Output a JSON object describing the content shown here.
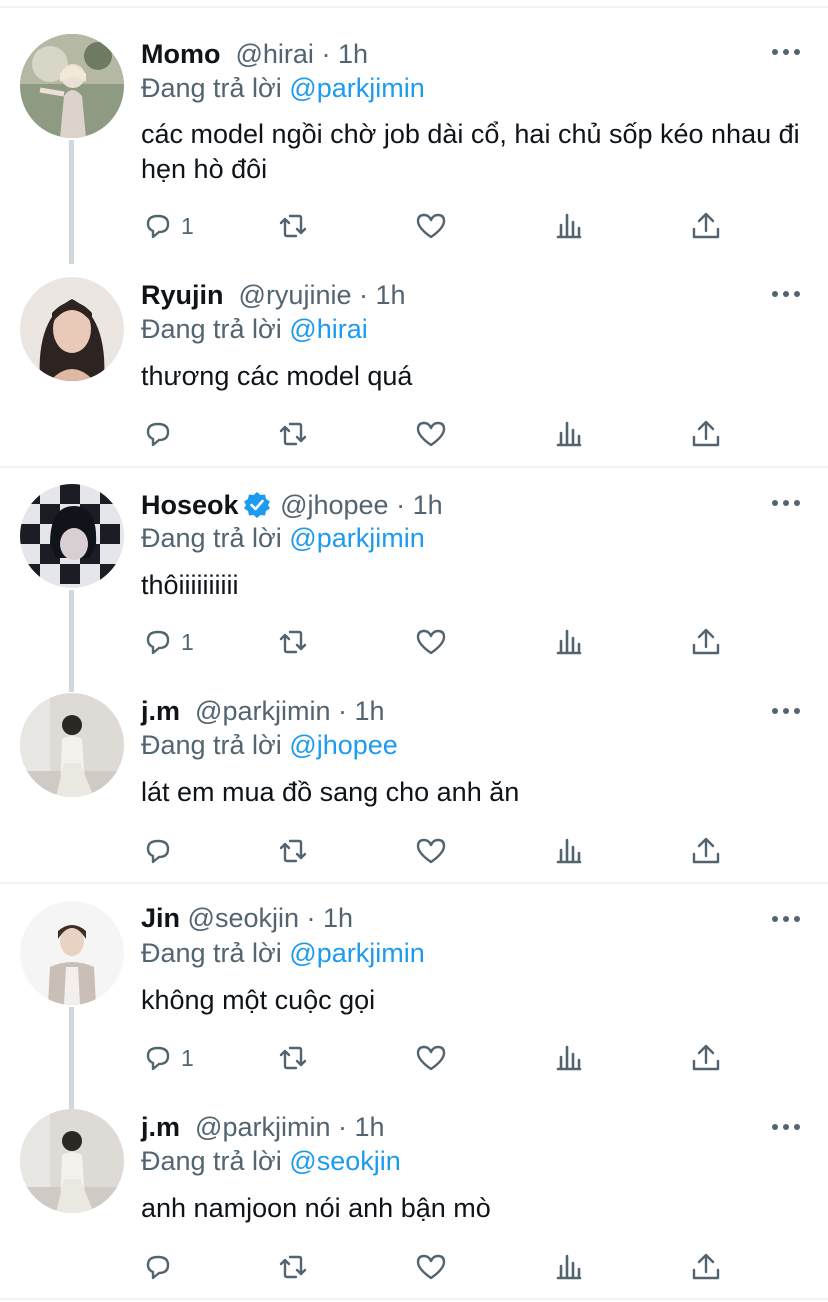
{
  "reply_prefix": "Đang trả lời",
  "colors": {
    "accent": "#1d9bf0",
    "secondary": "#536471",
    "thread_line": "#cfd9de",
    "divider": "#eff3f4"
  },
  "tweets": [
    {
      "name": "Momo",
      "handle": "@hirai",
      "time": "· 1h",
      "verified": false,
      "reply_to": "@parkjimin",
      "text": "các model ngồi chờ job dài cổ, hai chủ sốp kéo nhau đi hẹn hò đôi",
      "reply_count": "1"
    },
    {
      "name": "Ryujin",
      "handle": "@ryujinie",
      "time": "· 1h",
      "verified": false,
      "reply_to": "@hirai",
      "text": "thương các model quá",
      "reply_count": ""
    },
    {
      "name": "Hoseok",
      "handle": "@jhopee",
      "time": "· 1h",
      "verified": true,
      "reply_to": "@parkjimin",
      "text": "thôiiiiiiiiii",
      "reply_count": "1"
    },
    {
      "name": "j.m",
      "handle": "@parkjimin",
      "time": "· 1h",
      "verified": false,
      "reply_to": "@jhopee",
      "text": "lát em mua đồ sang cho anh ăn",
      "reply_count": ""
    },
    {
      "name": "Jin",
      "handle": "@seokjin",
      "time": "· 1h",
      "verified": false,
      "reply_to": "@parkjimin",
      "text": "không một cuộc gọi",
      "reply_count": "1"
    },
    {
      "name": "j.m",
      "handle": "@parkjimin",
      "time": "· 1h",
      "verified": false,
      "reply_to": "@seokjin",
      "text": "anh namjoon nói anh bận mò",
      "reply_count": ""
    }
  ]
}
